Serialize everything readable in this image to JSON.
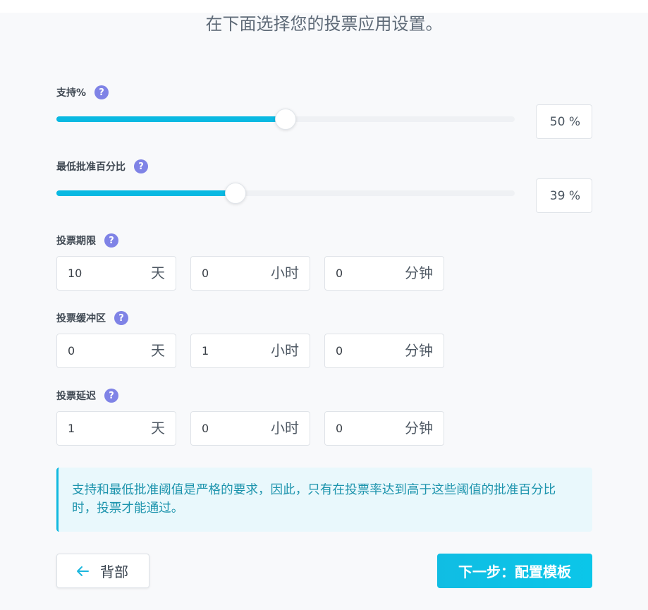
{
  "header": {
    "title": "在下面选择您的投票应用设置。"
  },
  "help_glyph": "?",
  "support": {
    "label": "支持%",
    "value": 50,
    "display": "50 %"
  },
  "min_approval": {
    "label": "最低批准百分比",
    "value": 39,
    "display": "39 %"
  },
  "vote_duration": {
    "label": "投票期限",
    "fields": [
      {
        "value": "10",
        "unit": "天"
      },
      {
        "value": "0",
        "unit": "小时"
      },
      {
        "value": "0",
        "unit": "分钟"
      }
    ]
  },
  "vote_buffer": {
    "label": "投票缓冲区",
    "fields": [
      {
        "value": "0",
        "unit": "天"
      },
      {
        "value": "1",
        "unit": "小时"
      },
      {
        "value": "0",
        "unit": "分钟"
      }
    ]
  },
  "vote_delay": {
    "label": "投票延迟",
    "fields": [
      {
        "value": "1",
        "unit": "天"
      },
      {
        "value": "0",
        "unit": "小时"
      },
      {
        "value": "0",
        "unit": "分钟"
      }
    ]
  },
  "notice": {
    "text": "支持和最低批准阈值是严格的要求，因此，只有在投票率达到高于这些阈值的批准百分比时，投票才能通过。"
  },
  "buttons": {
    "back": "背部",
    "next": "下一步：配置模板"
  },
  "icons": {
    "help": "help-icon",
    "back": "arrow-left-icon"
  },
  "colors": {
    "accent": "#0ab9e2",
    "help": "#7f83e6",
    "notice_text": "#1d94ad",
    "background": "#f8f9fb"
  }
}
